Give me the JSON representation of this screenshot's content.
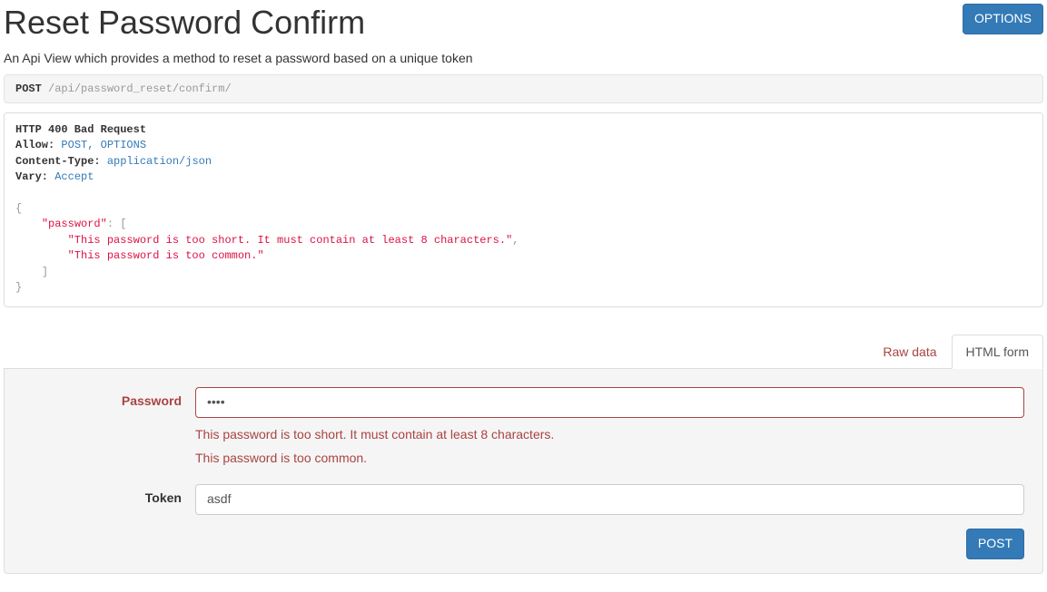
{
  "header": {
    "title": "Reset Password Confirm",
    "options_label": "OPTIONS",
    "description": "An Api View which provides a method to reset a password based on a unique token"
  },
  "request": {
    "method": "POST",
    "path": "/api/password_reset/confirm/"
  },
  "response": {
    "status_line": "HTTP 400 Bad Request",
    "headers": {
      "allow_label": "Allow:",
      "allow_value": "POST, OPTIONS",
      "content_type_label": "Content-Type:",
      "content_type_value": "application/json",
      "vary_label": "Vary:",
      "vary_value": "Accept"
    },
    "body": {
      "password": [
        "This password is too short. It must contain at least 8 characters.",
        "This password is too common."
      ]
    }
  },
  "tabs": {
    "raw_label": "Raw data",
    "html_form_label": "HTML form"
  },
  "form": {
    "password": {
      "label": "Password",
      "value": "••••",
      "errors": [
        "This password is too short. It must contain at least 8 characters.",
        "This password is too common."
      ]
    },
    "token": {
      "label": "Token",
      "value": "asdf"
    },
    "submit_label": "POST"
  }
}
